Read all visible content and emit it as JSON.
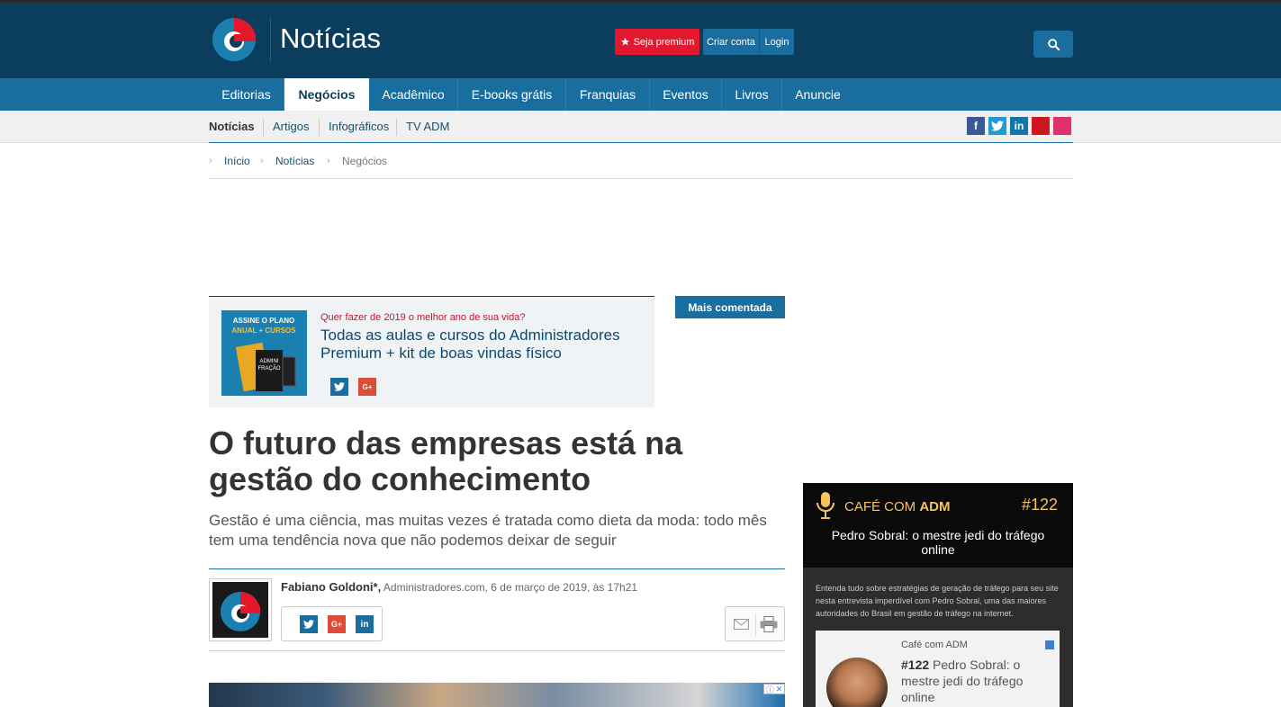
{
  "header": {
    "site_title": "Notícias",
    "premium_label": "Seja premium",
    "create_account_label": "Criar conta",
    "login_label": "Login",
    "brand_color": "#0b3d5c",
    "accent_color": "#e3182d"
  },
  "nav": {
    "items": [
      {
        "label": "Editorias"
      },
      {
        "label": "Negócios",
        "active": true
      },
      {
        "label": "Acadêmico"
      },
      {
        "label": "E-books grátis"
      },
      {
        "label": "Franquias"
      },
      {
        "label": "Eventos"
      },
      {
        "label": "Livros"
      },
      {
        "label": "Anuncie"
      }
    ]
  },
  "subnav": {
    "items": [
      {
        "label": "Notícias",
        "active": true
      },
      {
        "label": "Artigos"
      },
      {
        "label": "Infográficos"
      },
      {
        "label": "TV ADM"
      }
    ],
    "social": [
      "facebook-icon",
      "twitter-icon",
      "linkedin-icon",
      "youtube-icon",
      "instagram-icon"
    ]
  },
  "breadcrumb": [
    "Início",
    "Notícias",
    "Negócios"
  ],
  "promo": {
    "kicker": "Quer fazer de 2019 o melhor ano de sua vida?",
    "title": "Todas as aulas e cursos do Administradores Premium + kit de boas vindas físico",
    "image_text": "ASSINE O PLANO ANUAL + CURSOS"
  },
  "sidebar_tab": {
    "label": "Mais comentada"
  },
  "article": {
    "headline": "O futuro das empresas está na gestão do conhecimento",
    "subtitle": "Gestão é uma ciência, mas muitas vezes é tratada como dieta da moda: todo mês tem uma tendência nova que não podemos deixar de seguir",
    "author": "Fabiano Goldoni*,",
    "source_date": "Administradores.com, 6 de março de 2019, às 17h21"
  },
  "podcast": {
    "brand_prefix": "CAFÉ COM ",
    "brand_bold": "ADM",
    "episode": "#122",
    "title": "Pedro Sobral: o mestre jedi do tráfego online",
    "description": "Entenda tudo sobre estratégias de geração de tráfego para seu site nesta entrevista imperdível com Pedro Sobral, uma das maiores autoridades do Brasil em gestão de tráfego na internet.",
    "card_show": "Café com ADM",
    "card_episode": "#122",
    "card_title": "Pedro Sobral: o mestre jedi do tráfego online"
  }
}
